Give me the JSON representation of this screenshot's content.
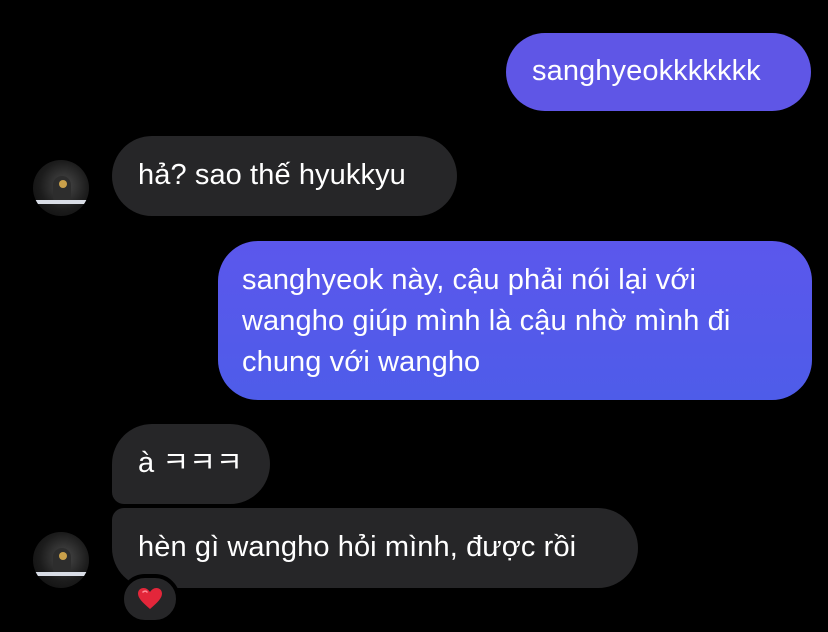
{
  "messages": [
    {
      "sender": "me",
      "text": "sanghyeokkkkkkk"
    },
    {
      "sender": "other",
      "text": "hả? sao thế hyukkyu"
    },
    {
      "sender": "me",
      "lines": [
        "sanghyeok này, cậu phải nói lại với",
        "wangho giúp mình là cậu nhờ mình đi",
        "chung với wangho"
      ]
    },
    {
      "sender": "other",
      "text": "à ㅋㅋㅋ"
    },
    {
      "sender": "other",
      "text": "hèn gì wangho hỏi mình, được rồi",
      "reaction": "❤️"
    }
  ],
  "colors": {
    "sent_bubble": "#5f56e6",
    "received_bubble": "#262628",
    "background": "#000000"
  }
}
